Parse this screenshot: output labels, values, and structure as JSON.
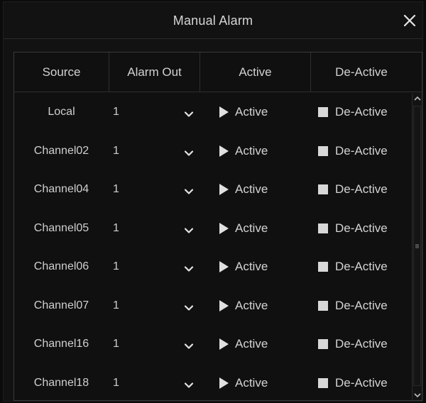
{
  "dialog": {
    "title": "Manual Alarm",
    "close_icon": "close-icon"
  },
  "table": {
    "headers": {
      "source": "Source",
      "alarm_out": "Alarm Out",
      "active": "Active",
      "deactive": "De-Active"
    },
    "rows": [
      {
        "source": "Local",
        "alarm_out": "1",
        "active": "Active",
        "deactive": "De-Active"
      },
      {
        "source": "Channel02",
        "alarm_out": "1",
        "active": "Active",
        "deactive": "De-Active"
      },
      {
        "source": "Channel04",
        "alarm_out": "1",
        "active": "Active",
        "deactive": "De-Active"
      },
      {
        "source": "Channel05",
        "alarm_out": "1",
        "active": "Active",
        "deactive": "De-Active"
      },
      {
        "source": "Channel06",
        "alarm_out": "1",
        "active": "Active",
        "deactive": "De-Active"
      },
      {
        "source": "Channel07",
        "alarm_out": "1",
        "active": "Active",
        "deactive": "De-Active"
      },
      {
        "source": "Channel16",
        "alarm_out": "1",
        "active": "Active",
        "deactive": "De-Active"
      },
      {
        "source": "Channel18",
        "alarm_out": "1",
        "active": "Active",
        "deactive": "De-Active"
      }
    ]
  },
  "icons": {
    "dropdown": "chevron-down-icon",
    "active": "play-icon",
    "deactive": "stop-icon",
    "scroll_up": "chevron-up-icon",
    "scroll_down": "chevron-down-icon"
  },
  "colors": {
    "background": "#121212",
    "text": "#d3d3d3",
    "border": "#3a3a3a"
  }
}
